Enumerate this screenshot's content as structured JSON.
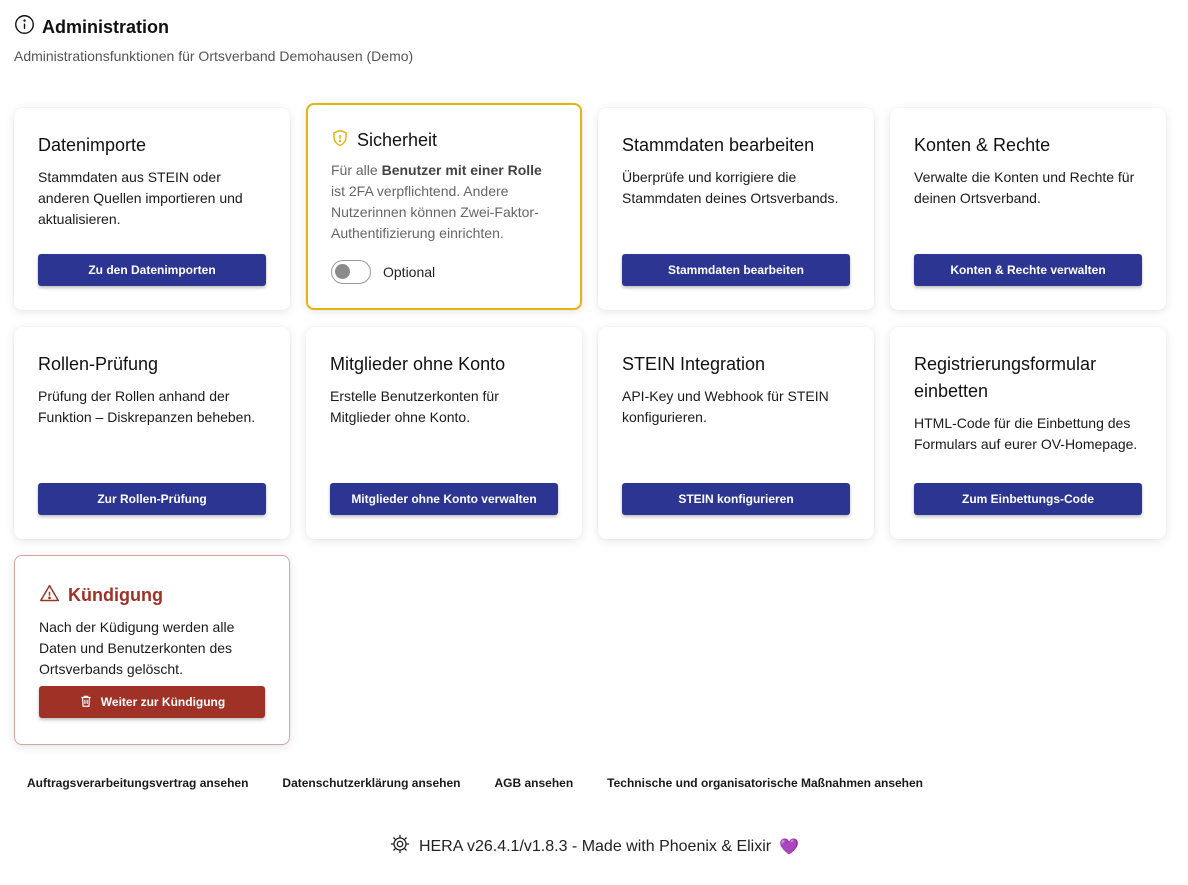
{
  "header": {
    "title": "Administration",
    "subtitle": "Administrationsfunktionen für Ortsverband Demohausen (Demo)"
  },
  "cards": {
    "import": {
      "title": "Datenimporte",
      "text": "Stammdaten aus STEIN oder anderen Quellen importieren und aktualisieren.",
      "button": "Zu den Datenimporten"
    },
    "security": {
      "title": "Sicherheit",
      "text_pre": "Für alle ",
      "text_bold": "Benutzer mit einer Rolle",
      "text_post": " ist 2FA verpflichtend. Andere Nutzerinnen können Zwei-Faktor-Authentifizierung einrichten.",
      "toggle_label": "Optional",
      "toggle_on": false,
      "accent": "#e3b412"
    },
    "masterdata": {
      "title": "Stammdaten bearbeiten",
      "text": "Überprüfe und korrigiere die Stammdaten deines Ortsverbands.",
      "button": "Stammdaten bearbeiten"
    },
    "accounts": {
      "title": "Konten & Rechte",
      "text": "Verwalte die Konten und Rechte für deinen Ortsverband.",
      "button": "Konten & Rechte verwalten"
    },
    "roles": {
      "title": "Rollen-Prüfung",
      "text": "Prüfung der Rollen anhand der Funktion – Diskrepanzen beheben.",
      "button": "Zur Rollen-Prüfung"
    },
    "members": {
      "title": "Mitglieder ohne Konto",
      "text": "Erstelle Benutzerkonten für Mitglieder ohne Konto.",
      "button": "Mitglieder ohne Konto verwalten"
    },
    "stein": {
      "title": "STEIN Integration",
      "text": "API-Key und Webhook für STEIN konfigurieren.",
      "button": "STEIN konfigurieren"
    },
    "embed": {
      "title": "Registrierungsformular einbetten",
      "text": "HTML-Code für die Einbettung des Formulars auf eurer OV-Homepage.",
      "button": "Zum Einbettungs-Code"
    },
    "cancel": {
      "title": "Kündigung",
      "text": "Nach der Küdigung werden alle Daten und Benutzerkonten des Ortsverbands gelöscht.",
      "button": "Weiter zur Kündigung",
      "accent": "#a03127"
    }
  },
  "links": [
    "Auftragsverarbeitungsvertrag ansehen",
    "Datenschutzerklärung ansehen",
    "AGB ansehen",
    "Technische und organisatorische Maßnahmen ansehen"
  ],
  "footer": {
    "text": "HERA v26.4.1/v1.8.3 - Made with Phoenix & Elixir",
    "heart": "💜"
  },
  "colors": {
    "primary_button": "#2c3592",
    "danger": "#a03127",
    "warning": "#e3b412"
  },
  "icons": {
    "header": "info-icon",
    "security": "shield-icon",
    "cancel": "warning-triangle-icon",
    "cancel_button": "trash-icon",
    "footer": "gear-logo-icon"
  }
}
